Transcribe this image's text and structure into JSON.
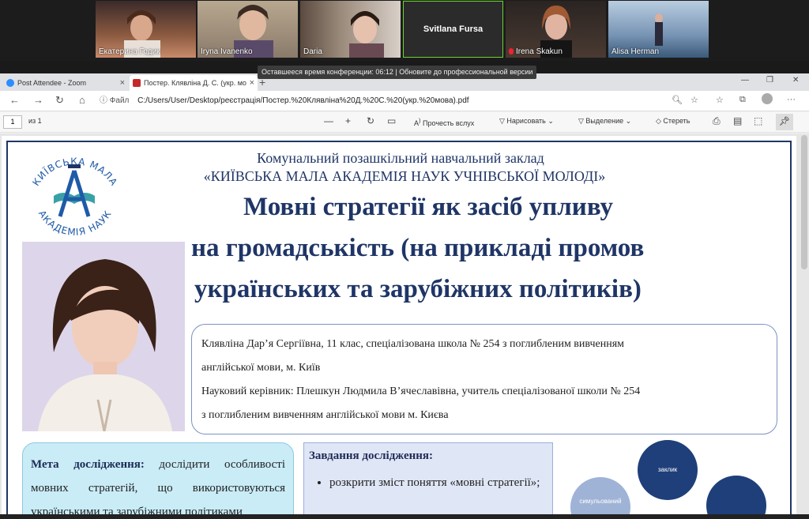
{
  "zoom": {
    "participants": [
      {
        "name": "Екатерина Годик",
        "color": "#5a3a30"
      },
      {
        "name": "Iryna Ivanenko",
        "color": "#8a7a6a"
      },
      {
        "name": "Daria",
        "color": "#6b5548"
      },
      {
        "name": "Svitlana Fursa",
        "active": true
      },
      {
        "name": "Irena Skakun",
        "muted": true,
        "color": "#6e5a48"
      },
      {
        "name": "Alisa Herman",
        "color": "#7894b4"
      }
    ],
    "tooltip": "Оставшееся время конференции: 06:12 | Обновите до профессиональной версии"
  },
  "browser": {
    "tabs": [
      {
        "label": "Post Attendee - Zoom",
        "icon_color": "#2d8cff"
      },
      {
        "label": "Постер. Клявліна Д. С. (укр. мо",
        "icon_color": "#c62828"
      }
    ],
    "address": {
      "scheme_label": "Файл",
      "url": "C:/Users/User/Desktop/реєстрація/Постер.%20Клявліна%20Д.%20С.%20(укр.%20мова).pdf"
    },
    "pdf_toolbar": {
      "page": "1",
      "of_pages": "из 1",
      "read_aloud": "Прочесть вслух",
      "draw": "Нарисовать",
      "highlight": "Выделение",
      "erase": "Стереть"
    }
  },
  "poster": {
    "logo_text_top": "КИЇВСЬКА МАЛА",
    "logo_text_bottom": "АКАДЕМІЯ НАУК",
    "institution_line1": "Комунальний позашкільний навчальний заклад",
    "institution_line2": "«КИЇВСЬКА МАЛА АКАДЕМІЯ НАУК УЧНІВСЬКОЇ МОЛОДІ»",
    "title_line1": "Мовні стратегії як засіб упливу",
    "title_line2": "на громадськість (на прикладі промов",
    "title_line3": "українських та зарубіжних політиків)",
    "author_line1": "Клявліна Дар’я Сергіївна, 11 клас, спеціалізована школа № 254 з поглибленим вивченням",
    "author_line2": "англійської мови, м. Київ",
    "author_line3": "Науковий керівник: Плешкун Людмила В’ячеславівна, учитель спеціалізованої школи № 254",
    "author_line4": "з поглибленим вивченням англійської мови м. Києва",
    "goal_head": "Мета дослідження:",
    "goal_text": " дослідити особливості мовних стратегій, що використовуються українськими та зарубіжними політиками",
    "tasks_head": "Завдання дослідження:",
    "task1": "розкрити зміст поняття «мовні стратегії»;",
    "diagram_nodes": [
      "заклик",
      "симульований"
    ]
  }
}
